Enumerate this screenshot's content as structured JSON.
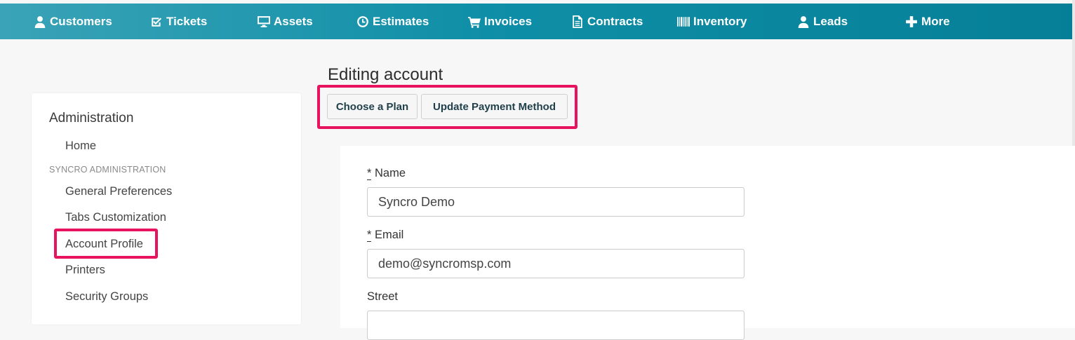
{
  "nav": {
    "items": [
      {
        "label": "Customers",
        "icon": "user-icon"
      },
      {
        "label": "Tickets",
        "icon": "check-square-icon"
      },
      {
        "label": "Assets",
        "icon": "monitor-icon"
      },
      {
        "label": "Estimates",
        "icon": "clock-icon"
      },
      {
        "label": "Invoices",
        "icon": "cart-icon"
      },
      {
        "label": "Contracts",
        "icon": "document-icon"
      },
      {
        "label": "Inventory",
        "icon": "barcode-icon"
      },
      {
        "label": "Leads",
        "icon": "user-icon"
      },
      {
        "label": "More",
        "icon": "plus-icon"
      }
    ]
  },
  "sidebar": {
    "title": "Administration",
    "home": "Home",
    "section": "SYNCRO ADMINISTRATION",
    "items": [
      "General Preferences",
      "Tabs Customization",
      "Account Profile",
      "Printers",
      "Security Groups"
    ]
  },
  "main": {
    "title": "Editing account",
    "buttons": {
      "choose_plan": "Choose a Plan",
      "update_payment": "Update Payment Method"
    },
    "form": {
      "required_mark": "*",
      "name_label": "Name",
      "name_value": "Syncro Demo",
      "email_label": "Email",
      "email_value": "demo@syncromsp.com",
      "street_label": "Street",
      "street_value": ""
    }
  },
  "colors": {
    "nav_start": "#3aa3b7",
    "nav_end": "#057f97",
    "highlight": "#e8135f"
  }
}
